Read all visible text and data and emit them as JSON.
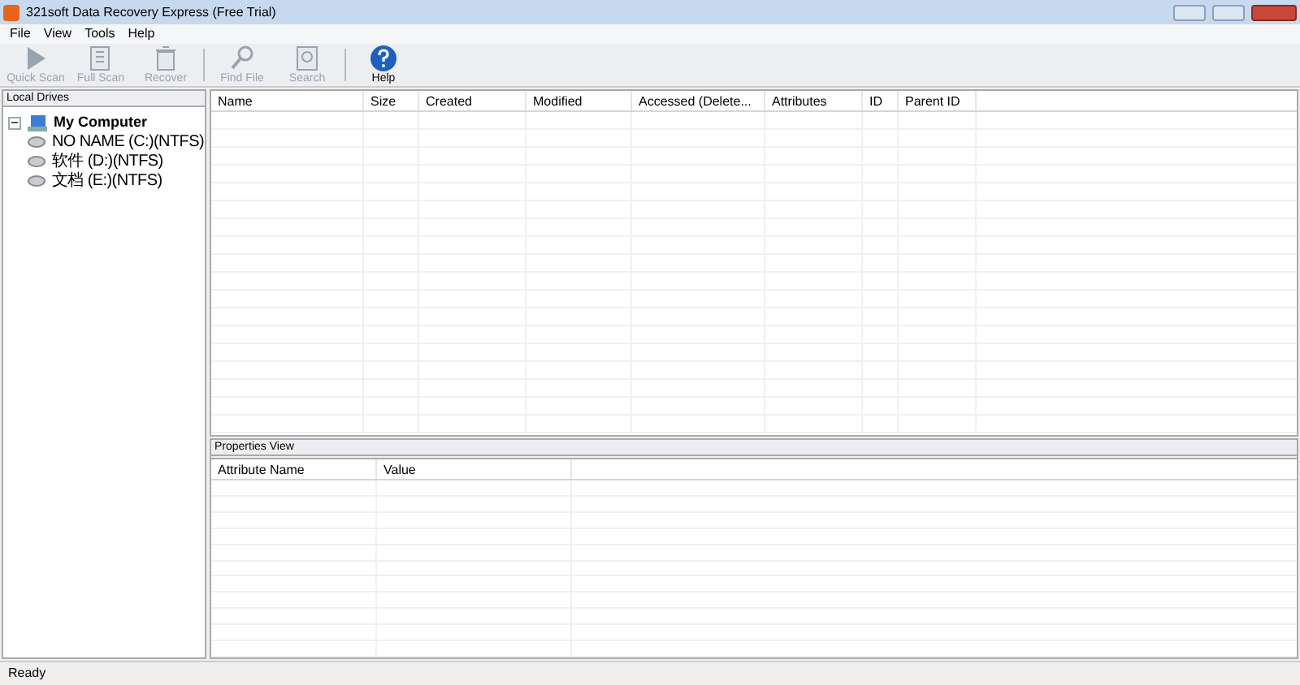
{
  "window": {
    "title": "321soft Data Recovery Express (Free Trial)"
  },
  "menu": [
    "File",
    "View",
    "Tools",
    "Help"
  ],
  "toolbar": [
    {
      "label": "Quick Scan",
      "kind": "play",
      "disabled": true
    },
    {
      "label": "Full Scan",
      "kind": "scan",
      "disabled": true
    },
    {
      "label": "Recover",
      "kind": "recover",
      "disabled": true
    },
    {
      "label": "Find File",
      "kind": "find",
      "disabled": true
    },
    {
      "label": "Search",
      "kind": "search",
      "disabled": true
    },
    {
      "label": "Help",
      "kind": "help",
      "disabled": false
    }
  ],
  "local_drives": {
    "title": "Local Drives",
    "tree": [
      {
        "label": "My Computer",
        "kind": "computer",
        "expanded": true,
        "children": [
          {
            "label": "NO NAME (C:)(NTFS)",
            "kind": "drive"
          },
          {
            "label": "软件 (D:)(NTFS)",
            "kind": "drive"
          },
          {
            "label": "文档 (E:)(NTFS)",
            "kind": "drive"
          }
        ]
      }
    ]
  },
  "file_table": {
    "columns": [
      "Name",
      "Size",
      "Created",
      "Modified",
      "Accessed (Delete...",
      "Attributes",
      "ID",
      "Parent ID"
    ]
  },
  "properties_view": {
    "title": "Properties View",
    "columns": [
      "Attribute Name",
      "Value"
    ]
  },
  "status_bar": "Ready"
}
